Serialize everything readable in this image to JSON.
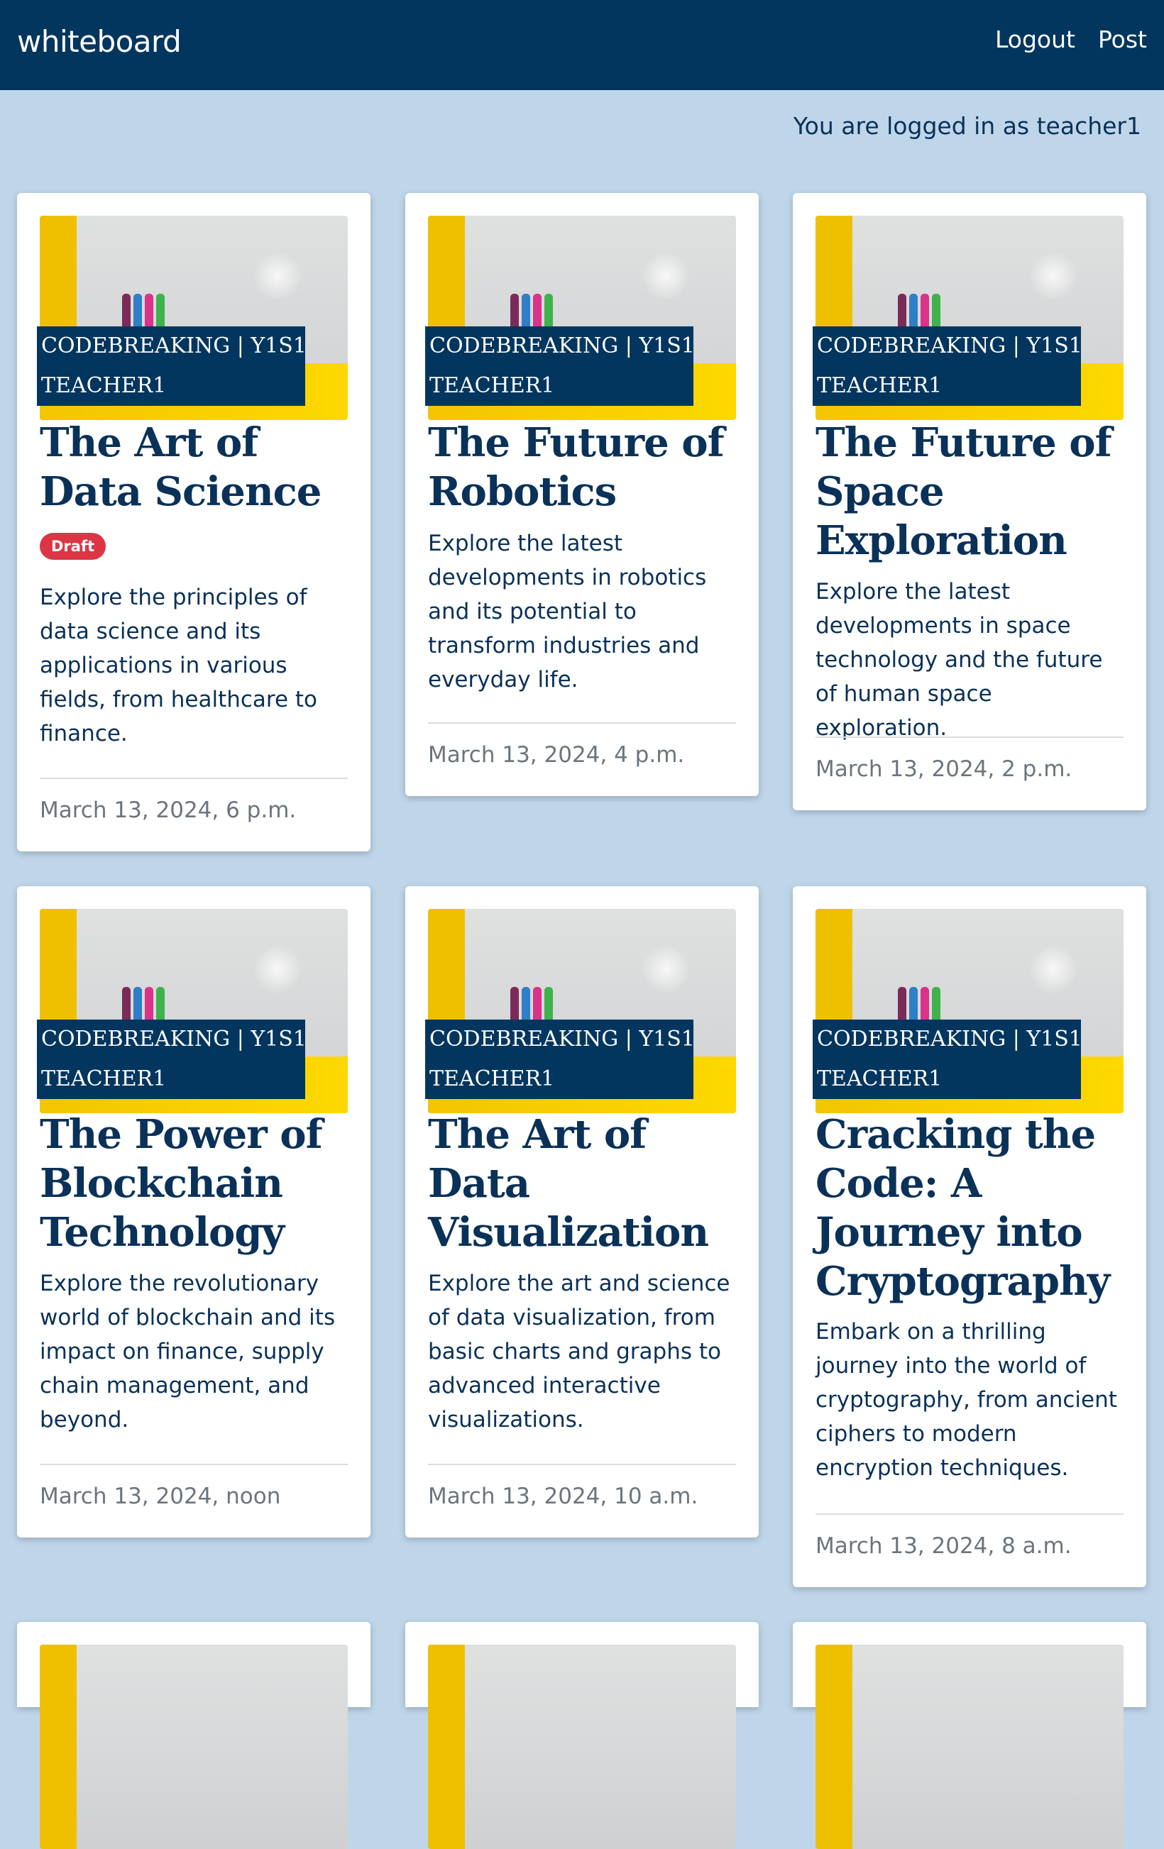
{
  "navbar": {
    "brand": "whiteboard",
    "links": [
      "Logout",
      "Post"
    ]
  },
  "login_status": "You are logged in as teacher1",
  "posts": [
    {
      "category": "CODEBREAKING | Y1S1",
      "author": "TEACHER1",
      "title": "The Art of Data Science",
      "badge": "Draft",
      "description": "Explore the principles of data science and its applications in various fields, from healthcare to finance.",
      "date": "March 13, 2024, 6 p.m."
    },
    {
      "category": "CODEBREAKING | Y1S1",
      "author": "TEACHER1",
      "title": "The Future of Robotics",
      "description": "Explore the latest developments in robotics and its potential to transform industries and everyday life.",
      "date": "March 13, 2024, 4 p.m."
    },
    {
      "category": "CODEBREAKING | Y1S1",
      "author": "TEACHER1",
      "title": "The Future of Space Exploration",
      "description": "Explore the latest developments in space technology and the future of human space exploration.",
      "date": "March 13, 2024, 2 p.m."
    },
    {
      "category": "CODEBREAKING | Y1S1",
      "author": "TEACHER1",
      "title": "The Power of Blockchain Technology",
      "description": "Explore the revolutionary world of blockchain and its impact on finance, supply chain management, and beyond.",
      "date": "March 13, 2024, noon"
    },
    {
      "category": "CODEBREAKING | Y1S1",
      "author": "TEACHER1",
      "title": "The Art of Data Visualization",
      "description": "Explore the art and science of data visualization, from basic charts and graphs to advanced interactive visualizations.",
      "date": "March 13, 2024, 10 a.m."
    },
    {
      "category": "CODEBREAKING | Y1S1",
      "author": "TEACHER1",
      "title": "Cracking the Code: A Journey into Cryptography",
      "description": "Embark on a thrilling journey into the world of cryptography, from ancient ciphers to modern encryption techniques.",
      "date": "March 13, 2024, 8 a.m."
    }
  ],
  "colors": {
    "navbar": "#03365e",
    "page_background": "#bfd6ea",
    "draft_badge": "#dc3545",
    "thumbnail_accent": "#f3c600"
  }
}
